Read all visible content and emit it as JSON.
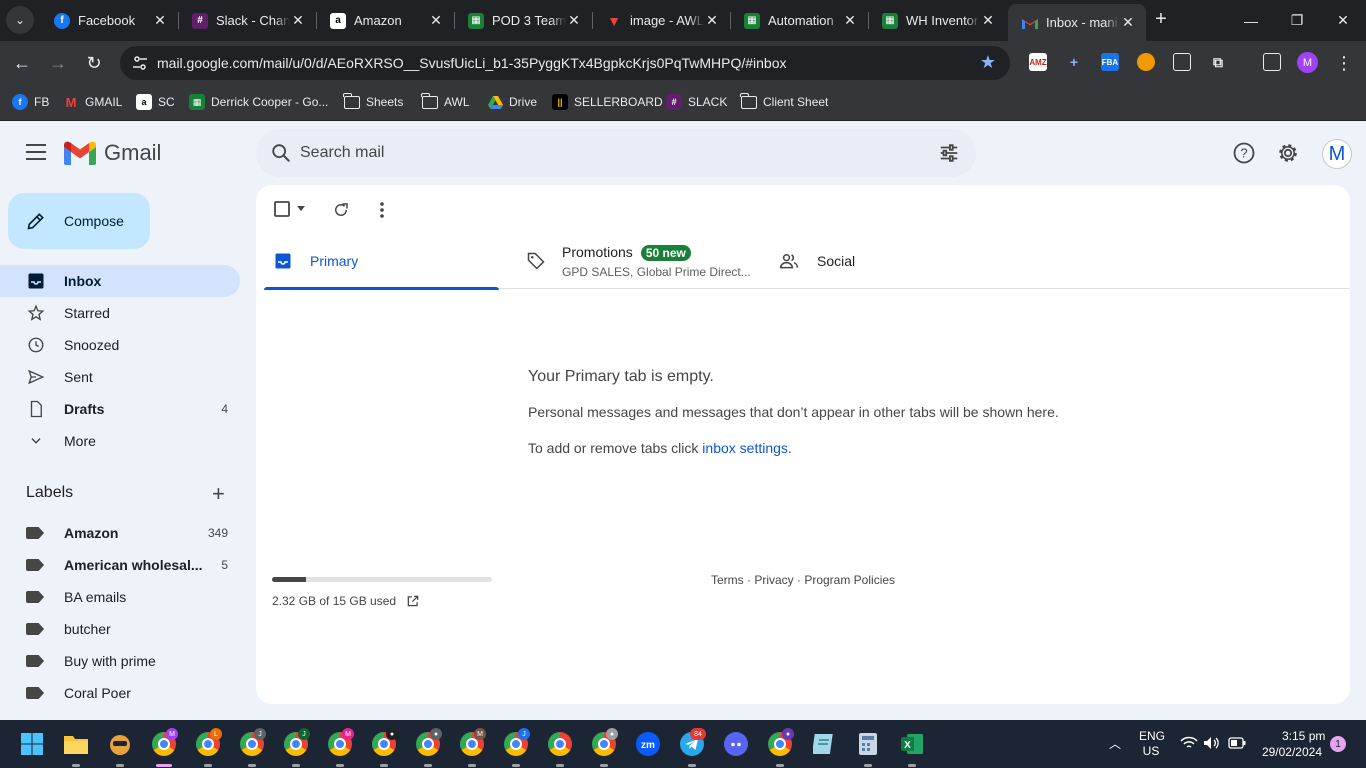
{
  "browser": {
    "tabs": [
      {
        "title": "Facebook",
        "icon": "facebook-icon",
        "color": "#1877f2"
      },
      {
        "title": "Slack - Chan",
        "icon": "slack-icon",
        "color": "#611f69"
      },
      {
        "title": "Amazon",
        "icon": "amazon-icon",
        "color": "#000000"
      },
      {
        "title": "POD 3 Team",
        "icon": "sheets-icon",
        "color": "#188038"
      },
      {
        "title": "image - AWL",
        "icon": "awl-icon",
        "color": "#c5221f"
      },
      {
        "title": "Automation",
        "icon": "sheets-icon",
        "color": "#188038"
      },
      {
        "title": "WH Inventor",
        "icon": "sheets-icon",
        "color": "#188038"
      },
      {
        "title": "Inbox - mani",
        "icon": "gmail-icon",
        "color": "#ea4335",
        "active": true
      }
    ],
    "url": "mail.google.com/mail/u/0/d/AEoRXRSO__SvusfUicLi_b1-35PyggKTx4BgpkcKrjs0PqTwMHPQ/#inbox",
    "profile_initial": "M",
    "extensions": [
      "AMZ",
      "+",
      "FBA",
      "",
      "",
      ""
    ],
    "bookmarks": [
      {
        "label": "FB",
        "type": "facebook"
      },
      {
        "label": "GMAIL",
        "type": "gmail"
      },
      {
        "label": "SC",
        "type": "amazon"
      },
      {
        "label": "Derrick Cooper - Go...",
        "type": "sheets"
      },
      {
        "label": "Sheets",
        "type": "folder"
      },
      {
        "label": "AWL",
        "type": "folder"
      },
      {
        "label": "Drive",
        "type": "drive"
      },
      {
        "label": "SELLERBOARD",
        "type": "sellerboard"
      },
      {
        "label": "SLACK",
        "type": "slack"
      },
      {
        "label": "Client Sheet",
        "type": "folder"
      }
    ]
  },
  "gmail": {
    "logo_text": "Gmail",
    "search_placeholder": "Search mail",
    "avatar_initial": "M",
    "compose_label": "Compose",
    "nav": [
      {
        "label": "Inbox",
        "icon": "inbox-icon",
        "active": true,
        "count": ""
      },
      {
        "label": "Starred",
        "icon": "star-icon",
        "count": ""
      },
      {
        "label": "Snoozed",
        "icon": "clock-icon",
        "count": ""
      },
      {
        "label": "Sent",
        "icon": "send-icon",
        "count": ""
      },
      {
        "label": "Drafts",
        "icon": "draft-icon",
        "bold": true,
        "count": "4"
      },
      {
        "label": "More",
        "icon": "chevron-down-icon",
        "count": ""
      }
    ],
    "labels_heading": "Labels",
    "labels": [
      {
        "label": "Amazon",
        "count": "349",
        "bold": true
      },
      {
        "label": "American wholesal...",
        "count": "5",
        "bold": true
      },
      {
        "label": "BA emails",
        "count": ""
      },
      {
        "label": "butcher",
        "count": ""
      },
      {
        "label": "Buy with prime",
        "count": ""
      },
      {
        "label": "Coral Poer",
        "count": ""
      }
    ],
    "inbox_tabs": {
      "primary": "Primary",
      "promotions": "Promotions",
      "promotions_badge": "50 new",
      "promotions_senders": "GPD SALES, Global Prime Direct...",
      "social": "Social"
    },
    "empty_title": "Your Primary tab is empty.",
    "empty_desc": "Personal messages and messages that don’t appear in other tabs will be shown here.",
    "empty_hint_prefix": "To add or remove tabs click ",
    "empty_hint_link": "inbox settings",
    "empty_hint_suffix": ".",
    "storage_text": "2.32 GB of 15 GB used",
    "storage_fraction": 0.155,
    "footer": "Terms · Privacy · Program Policies"
  },
  "taskbar": {
    "lang_top": "ENG",
    "lang_bottom": "US",
    "time": "3:15 pm",
    "date": "29/02/2024",
    "notifications": "1",
    "telegram_badge": "84"
  },
  "colors": {
    "accent": "#0b57d0",
    "compose_bg": "#c2e7ff",
    "active_nav": "#d3e3fd",
    "promo_badge": "#188038"
  }
}
